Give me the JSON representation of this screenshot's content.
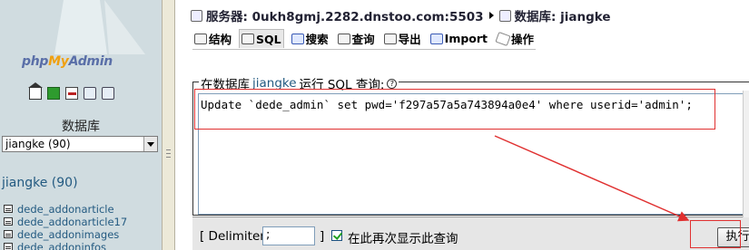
{
  "nav": {
    "logo": {
      "php": "php",
      "my": "My",
      "admin": "Admin"
    },
    "icons": [
      "home-icon",
      "exit-icon",
      "sql-icon",
      "docs-icon",
      "docs-icon-2"
    ],
    "databases_heading": "数据库",
    "db_select_value": "jiangke (90)",
    "current_db_link": "jiangke (90)",
    "tables": [
      "dede_addonarticle",
      "dede_addonarticle17",
      "dede_addonimages",
      "dede_addoninfos"
    ]
  },
  "breadcrumb": {
    "server_label": "服务器: 0ukh8gmj.2282.dnstoo.com:5503",
    "database_label": "数据库: jiangke"
  },
  "tabs": [
    {
      "label": "结构",
      "icon": "structure-icon"
    },
    {
      "label": "SQL",
      "icon": "sql-icon",
      "active": true
    },
    {
      "label": "搜索",
      "icon": "search-icon"
    },
    {
      "label": "查询",
      "icon": "query-icon"
    },
    {
      "label": "导出",
      "icon": "export-icon"
    },
    {
      "label": "Import",
      "icon": "import-icon"
    },
    {
      "label": "操作",
      "icon": "operations-icon"
    }
  ],
  "sql_form": {
    "legend_prefix": "在数据库",
    "legend_db": "jiangke",
    "legend_suffix": "运行 SQL 查询:",
    "query": "Update `dede_admin` set pwd='f297a57a5a743894a0e4' where userid='admin';",
    "delimiter_open": "[ Delimiter",
    "delimiter_value": ";",
    "delimiter_close": "]",
    "show_again_label": "在此再次显示此查询",
    "show_again_checked": true,
    "go_label": "执行"
  },
  "colors": {
    "nav_bg": "#d0dce0",
    "link": "#235a81",
    "highlight": "#e03030"
  }
}
